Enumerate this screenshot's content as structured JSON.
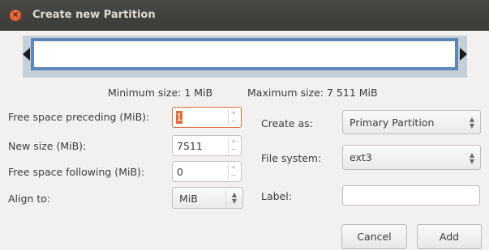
{
  "window": {
    "title": "Create new Partition",
    "close_glyph": "×"
  },
  "size_info": {
    "minimum": "Minimum size: 1 MiB",
    "maximum": "Maximum size: 7 511 MiB"
  },
  "fields": {
    "free_preceding": {
      "label": "Free space preceding (MiB):",
      "value": "1"
    },
    "new_size": {
      "label": "New size (MiB):",
      "value": "7511"
    },
    "free_following": {
      "label": "Free space following (MiB):",
      "value": "0"
    },
    "align_to": {
      "label": "Align to:",
      "value": "MiB"
    },
    "create_as": {
      "label": "Create as:",
      "value": "Primary Partition"
    },
    "file_system": {
      "label": "File system:",
      "value": "ext3"
    },
    "partition_label": {
      "label": "Label:",
      "value": ""
    }
  },
  "buttons": {
    "cancel": "Cancel",
    "add": "Add"
  },
  "colors": {
    "partition_border": "#5e86b6",
    "focus_accent": "#e06a3b",
    "titlebar": "#3b3a36"
  }
}
